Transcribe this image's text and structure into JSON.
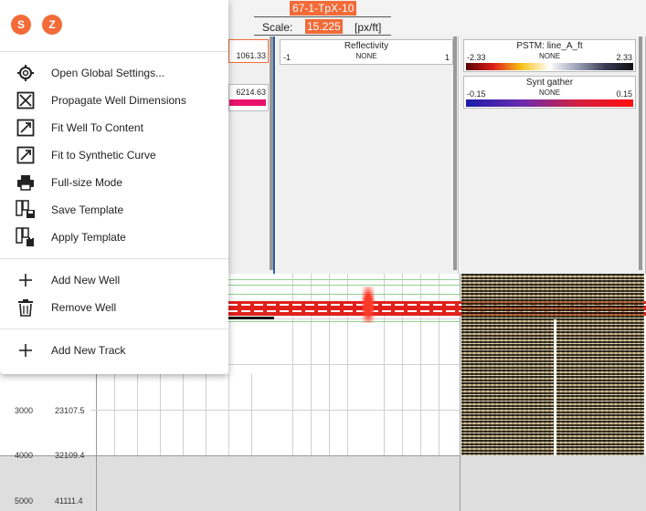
{
  "header": {
    "well_title": "67-1-TpX-10",
    "scale_label": "Scale:",
    "scale_value": "15.225",
    "scale_unit": "[px/ft]"
  },
  "left_track": {
    "value_top": "1061.33",
    "value_bottom": "6214.63"
  },
  "reflectivity_track": {
    "title": "Reflectivity",
    "sub": "NONE",
    "min": "-1",
    "max": "1"
  },
  "pstm_track": {
    "title": "PSTM: line_A_ft",
    "sub": "NONE",
    "min": "-2.33",
    "max": "2.33"
  },
  "synt_track": {
    "title": "Synt gather",
    "sub": "NONE",
    "min": "-0.15",
    "max": "0.15"
  },
  "depth_axis": [
    {
      "md": "3000",
      "tvd": "23107.5"
    },
    {
      "md": "4000",
      "tvd": "32109.4"
    },
    {
      "md": "5000",
      "tvd": "41111.4"
    }
  ],
  "menu": {
    "lock_icons": [
      "S",
      "Z"
    ],
    "group1": [
      {
        "label": "Open Global Settings...",
        "icon": "gear-icon"
      },
      {
        "label": "Propagate Well Dimensions",
        "icon": "propagate-icon"
      },
      {
        "label": "Fit Well To Content",
        "icon": "fit-content-icon"
      },
      {
        "label": "Fit to Synthetic Curve",
        "icon": "fit-curve-icon"
      },
      {
        "label": "Full-size Mode",
        "icon": "print-icon"
      },
      {
        "label": "Save Template",
        "icon": "save-template-icon"
      },
      {
        "label": "Apply Template",
        "icon": "apply-template-icon"
      }
    ],
    "group2": [
      {
        "label": "Add New Well",
        "icon": "plus-icon"
      },
      {
        "label": "Remove Well",
        "icon": "trash-icon"
      }
    ],
    "group3": [
      {
        "label": "Add New Track",
        "icon": "plus-icon"
      }
    ]
  },
  "colors": {
    "accent": "#f26b38",
    "well_line": "#2b5ea7"
  }
}
